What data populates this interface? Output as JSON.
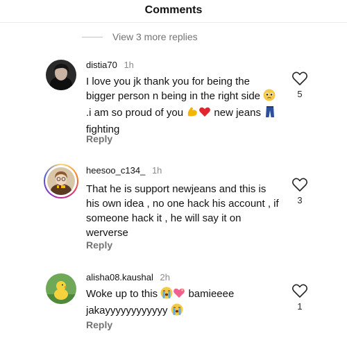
{
  "header": {
    "title": "Comments"
  },
  "thread": {
    "view_more_label": "View 3 more replies"
  },
  "comments": [
    {
      "username": "distia70",
      "time": "1h",
      "text_parts": [
        "I love you jk thank you for being the bigger person n being in the right side ",
        ".i am so proud of you ",
        " new jeans ",
        " fighting"
      ],
      "emoji_icons": [
        "pleading-face-icon",
        "flexed-biceps-icon",
        "red-heart-icon",
        "jeans-icon"
      ],
      "reply_label": "Reply",
      "like_count": "5"
    },
    {
      "username": "heesoo_c134_",
      "time": "1h",
      "text": "That he is support newjeans and this is his own idea , no one hack his account , if someone hack it , he will say it on werverse",
      "has_story_ring": true,
      "reply_label": "Reply",
      "like_count": "3"
    },
    {
      "username": "alisha08.kaushal",
      "time": "2h",
      "text_parts": [
        "Woke up to this ",
        " bamieeee jakayyyyyyyyyyyy "
      ],
      "emoji_icons": [
        "loudly-crying-face-icon",
        "sparkling-heart-icon",
        "loudly-crying-face-icon"
      ],
      "reply_label": "Reply",
      "like_count": "1"
    }
  ],
  "colors": {
    "text": "#111111",
    "secondary": "#737373",
    "divider": "#eaeaea",
    "story_ring": [
      "#feda75",
      "#fa7e1e",
      "#d62976",
      "#962fbf",
      "#4f5bd5"
    ]
  }
}
